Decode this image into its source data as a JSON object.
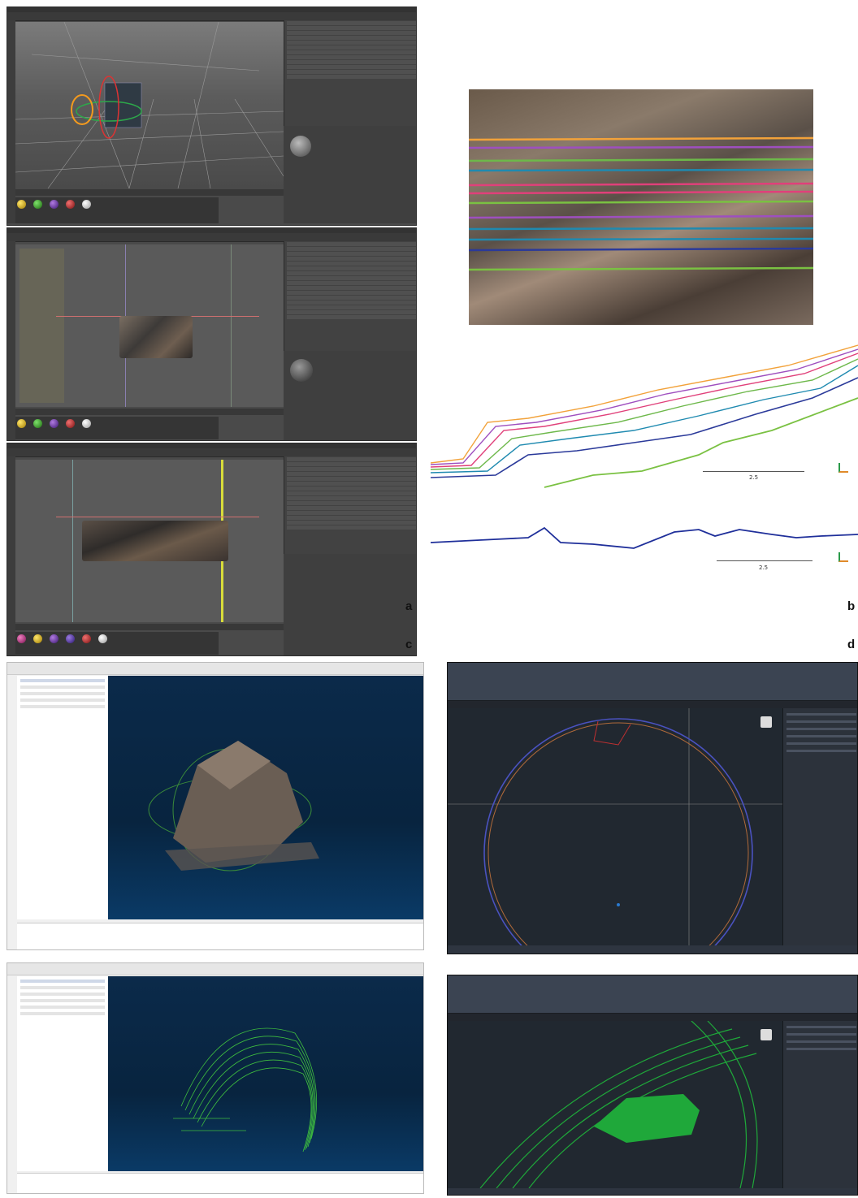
{
  "labels": {
    "a": "a",
    "b": "b",
    "c": "c",
    "d": "d"
  },
  "panel_b": {
    "scale_top": "2.5",
    "scale_bottom": "2.5"
  },
  "colors": {
    "c4d_bg": "#4a4a4a",
    "cc_view": "#08243f",
    "acad_bg": "#212830",
    "profile_blue": "#1f2f9a",
    "profile_green": "#7ac142"
  },
  "icons": {
    "c4d_materials": [
      "yellow",
      "green",
      "purple",
      "red",
      "white"
    ]
  }
}
